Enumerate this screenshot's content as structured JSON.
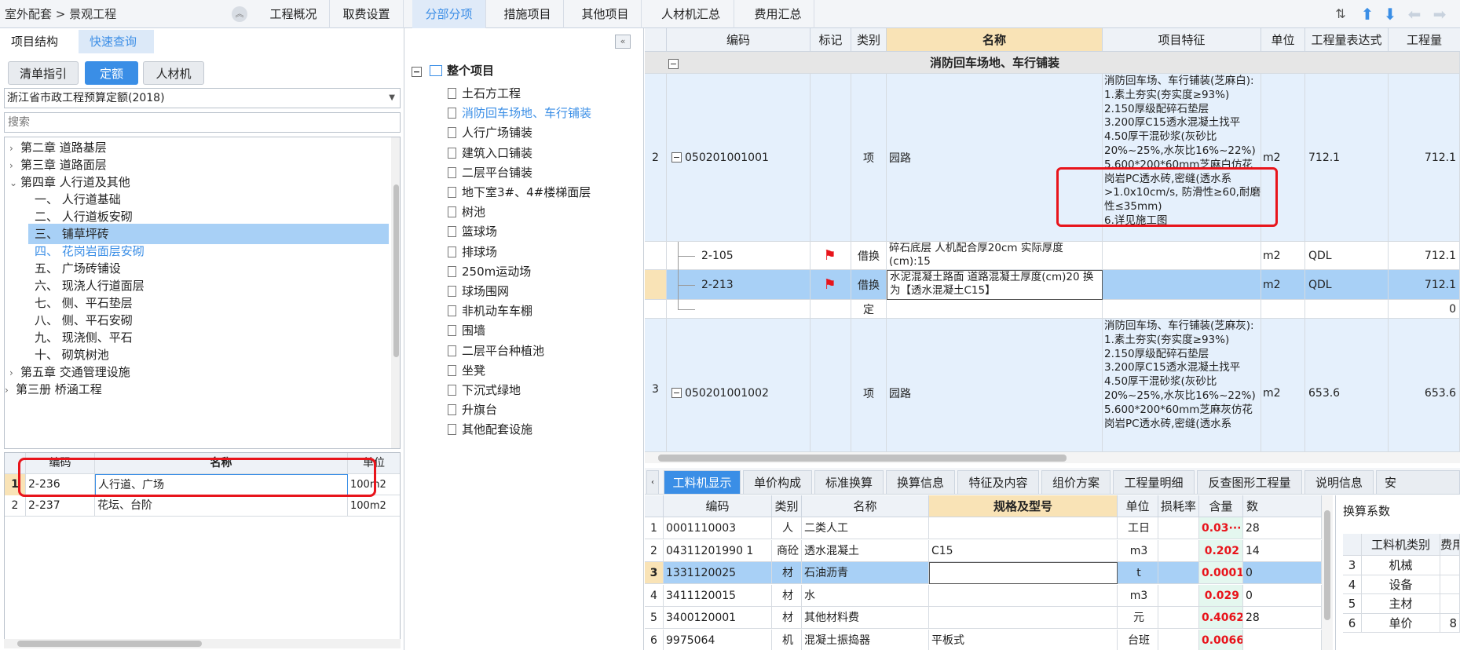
{
  "breadcrumb": "室外配套 > 景观工程",
  "top_tabs": [
    "工程概况",
    "取费设置",
    "分部分项",
    "措施项目",
    "其他项目",
    "人材机汇总",
    "费用汇总"
  ],
  "left": {
    "tabs": [
      "项目结构",
      "快速查询"
    ],
    "pills": [
      "清单指引",
      "定额",
      "人材机"
    ],
    "quota_lib": "浙江省市政工程预算定额(2018)",
    "search_placeholder": "搜索",
    "tree": [
      "第二章 道路基层",
      "第三章 道路面层",
      "第四章 人行道及其他",
      "一、 人行道基础",
      "二、 人行道板安砌",
      "三、 铺草坪砖",
      "四、 花岗岩面层安砌",
      "五、 广场砖铺设",
      "六、 现浇人行道面层",
      "七、 侧、平石垫层",
      "八、 侧、平石安砌",
      "九、 现浇侧、平石",
      "十、 砌筑树池",
      "第五章 交通管理设施",
      "第三册 桥涵工程"
    ],
    "table_headers": [
      "编码",
      "名称",
      "单位"
    ],
    "table_rows": [
      {
        "no": "1",
        "code": "2-236",
        "name": "人行道、广场",
        "unit": "100m2"
      },
      {
        "no": "2",
        "code": "2-237",
        "name": "花坛、台阶",
        "unit": "100m2"
      }
    ]
  },
  "mid": {
    "root": "整个项目",
    "items": [
      "土石方工程",
      "消防回车场地、车行铺装",
      "人行广场铺装",
      "建筑入口铺装",
      "二层平台铺装",
      "地下室3#、4#楼梯面层",
      "树池",
      "篮球场",
      "排球场",
      "250m运动场",
      "球场围网",
      "非机动车车棚",
      "围墙",
      "二层平台种植池",
      "坐凳",
      "下沉式绿地",
      "升旗台",
      "其他配套设施"
    ]
  },
  "grid": {
    "headers": [
      "编码",
      "标记",
      "类别",
      "名称",
      "项目特征",
      "单位",
      "工程量表达式",
      "工程量"
    ],
    "section_title": "消防回车场地、车行铺装",
    "rows": [
      {
        "no": "2",
        "code": "050201001001",
        "type": "项",
        "name": "园路",
        "feature": "消防回车场、车行铺装(芝麻白):\n1.素土夯实(夯实度≥93%)\n2.150厚级配碎石垫层\n3.200厚C15透水混凝土找平\n4.50厚干混砂浆(灰砂比20%~25%,水灰比16%~22%)\n5.600*200*60mm芝麻白仿花岗岩PC透水砖,密缝(透水系>1.0x10cm/s, 防滑性≥60,耐磨性≤35mm)\n6.详见施工图",
        "unit": "m2",
        "expr": "712.1",
        "qty": "712.1"
      },
      {
        "no": "",
        "code": "2-105",
        "type": "借换",
        "name": "碎石底层 人机配合厚20cm  实际厚度(cm):15",
        "feature": "",
        "unit": "m2",
        "expr": "QDL",
        "qty": "712.1"
      },
      {
        "no": "",
        "code": "2-213",
        "type": "借换",
        "name": "水泥混凝土路面 道路混凝土厚度(cm)20 换为【透水混凝土C15】",
        "feature": "",
        "unit": "m2",
        "expr": "QDL",
        "qty": "712.1"
      },
      {
        "no": "",
        "code": "",
        "type": "定",
        "name": "",
        "feature": "",
        "unit": "",
        "expr": "",
        "qty": "0"
      },
      {
        "no": "3",
        "code": "050201001002",
        "type": "项",
        "name": "园路",
        "feature": "消防回车场、车行铺装(芝麻灰):\n1.素土夯实(夯实度≥93%)\n2.150厚级配碎石垫层\n3.200厚C15透水混凝土找平\n4.50厚干混砂浆(灰砂比20%~25%,水灰比16%~22%)\n5.600*200*60mm芝麻灰仿花岗岩PC透水砖,密缝(透水系",
        "unit": "m2",
        "expr": "653.6",
        "qty": "653.6"
      }
    ]
  },
  "bottom_tabs": [
    "工料机显示",
    "单价构成",
    "标准换算",
    "换算信息",
    "特征及内容",
    "组价方案",
    "工程量明细",
    "反查图形工程量",
    "说明信息",
    "安"
  ],
  "bgrid": {
    "headers": [
      "编码",
      "类别",
      "名称",
      "规格及型号",
      "单位",
      "损耗率",
      "含量",
      "数"
    ],
    "rows": [
      {
        "no": "1",
        "code": "0001110003",
        "type": "人",
        "name": "二类人工",
        "spec": "",
        "unit": "工日",
        "loss": "",
        "content": "0.03···",
        "num": "28"
      },
      {
        "no": "2",
        "code": "04311201990 1",
        "type": "商砼",
        "name": "透水混凝土",
        "spec": "C15",
        "unit": "m3",
        "loss": "",
        "content": "0.202",
        "num": "14"
      },
      {
        "no": "3",
        "code": "1331120025",
        "type": "材",
        "name": "石油沥青",
        "spec": "",
        "unit": "t",
        "loss": "",
        "content": "0.0001",
        "num": "0"
      },
      {
        "no": "4",
        "code": "3411120015",
        "type": "材",
        "name": "水",
        "spec": "",
        "unit": "m3",
        "loss": "",
        "content": "0.029",
        "num": "0"
      },
      {
        "no": "5",
        "code": "3400120001",
        "type": "材",
        "name": "其他材料费",
        "spec": "",
        "unit": "元",
        "loss": "",
        "content": "0.4062",
        "num": "28"
      },
      {
        "no": "6",
        "code": "9975064",
        "type": "机",
        "name": "混凝土振捣器",
        "spec": "平板式",
        "unit": "台班",
        "loss": "",
        "content": "0.0066",
        "num": ""
      }
    ]
  },
  "conv": {
    "title": "换算系数",
    "headers": [
      "工料机类别",
      "费用"
    ],
    "rows": [
      {
        "no": "3",
        "label": "机械",
        "val": ""
      },
      {
        "no": "4",
        "label": "设备",
        "val": ""
      },
      {
        "no": "5",
        "label": "主材",
        "val": ""
      },
      {
        "no": "6",
        "label": "单价",
        "val": "8"
      }
    ]
  }
}
